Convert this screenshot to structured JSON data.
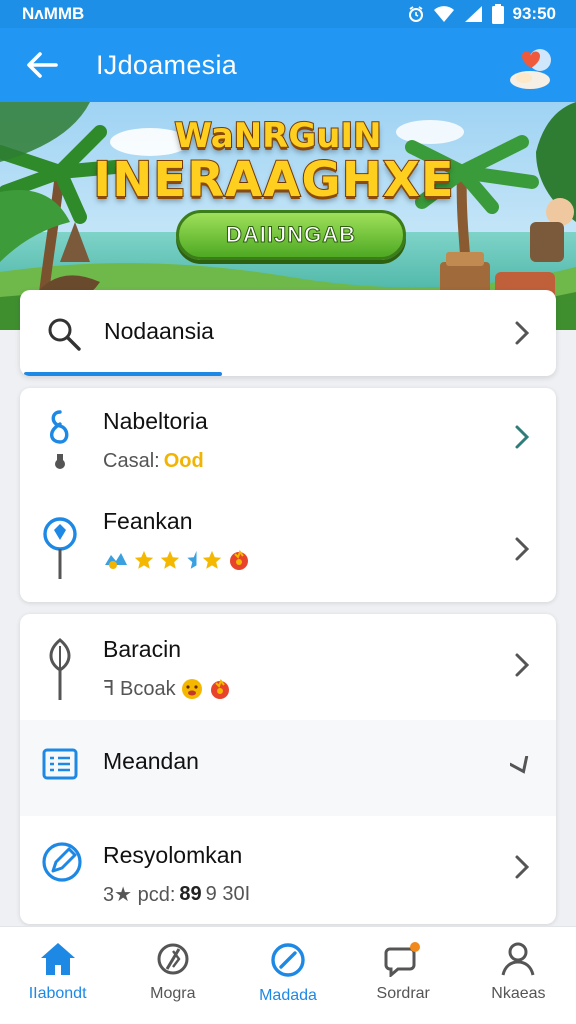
{
  "status_bar": {
    "carrier": "NʌMMB",
    "time": "93:50"
  },
  "app_bar": {
    "title": "IJdoamesia"
  },
  "banner": {
    "title_line1": "WaNRGuIN",
    "title_line2": "INERAAGHXE",
    "button_label": "DAIIJNGAB"
  },
  "search": {
    "label": "Nodaansia",
    "progress": 0.37
  },
  "card1": {
    "rows": [
      {
        "label": "Nabeltoria",
        "sub_prefix": "Casal:",
        "sub_value": "Ood"
      },
      {
        "label": "Feankan",
        "rating": 3
      }
    ]
  },
  "card2": {
    "rows": [
      {
        "label": "Baracin",
        "sub_prefix": "ꟻ Bcoak"
      },
      {
        "label": "Meandan"
      },
      {
        "label": "Resyolomkan",
        "sub_prefix": "3★ pcd:",
        "sub_bold": "89",
        "sub_suffix": "9 30I"
      }
    ]
  },
  "bottom_nav": {
    "items": [
      {
        "label": "IIabondt",
        "icon": "home-icon",
        "active": true
      },
      {
        "label": "Mogra",
        "icon": "compass-icon",
        "active": false
      },
      {
        "label": "Madada",
        "icon": "slash-circle-icon",
        "active": true
      },
      {
        "label": "Sordrar",
        "icon": "chat-bubble-icon",
        "active": false
      },
      {
        "label": "Nkaeas",
        "icon": "person-icon",
        "active": false
      }
    ]
  },
  "colors": {
    "primary": "#2196f3",
    "status_bar": "#1e8fe6",
    "accent_yellow": "#f2b400",
    "icon_blue": "#1e88e5"
  }
}
